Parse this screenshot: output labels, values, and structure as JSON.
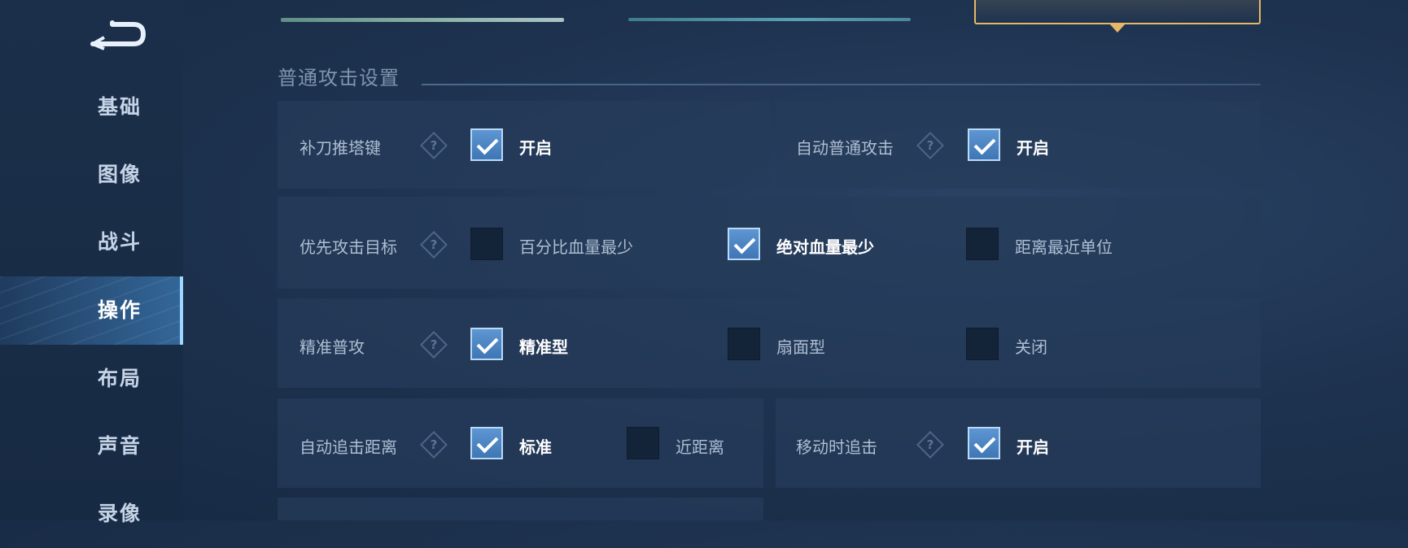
{
  "sidebar": {
    "items": [
      {
        "label": "基础"
      },
      {
        "label": "图像"
      },
      {
        "label": "战斗"
      },
      {
        "label": "操作"
      },
      {
        "label": "布局"
      },
      {
        "label": "声音"
      },
      {
        "label": "录像"
      }
    ],
    "active_index": 3
  },
  "tabs": {
    "active_index": 2,
    "count": 3
  },
  "section": {
    "title": "普通攻击设置"
  },
  "settings": {
    "last_hit": {
      "label": "补刀推塔键",
      "option": "开启",
      "checked": true
    },
    "auto_attack": {
      "label": "自动普通攻击",
      "option": "开启",
      "checked": true
    },
    "priority_target": {
      "label": "优先攻击目标",
      "options": [
        {
          "label": "百分比血量最少",
          "checked": false
        },
        {
          "label": "绝对血量最少",
          "checked": true
        },
        {
          "label": "距离最近单位",
          "checked": false
        }
      ]
    },
    "precise_attack": {
      "label": "精准普攻",
      "options": [
        {
          "label": "精准型",
          "checked": true
        },
        {
          "label": "扇面型",
          "checked": false
        },
        {
          "label": "关闭",
          "checked": false
        }
      ]
    },
    "chase_distance": {
      "label": "自动追击距离",
      "options": [
        {
          "label": "标准",
          "checked": true
        },
        {
          "label": "近距离",
          "checked": false
        }
      ]
    },
    "chase_while_moving": {
      "label": "移动时追击",
      "option": "开启",
      "checked": true
    }
  },
  "colors": {
    "accent_gold": "#e6b765",
    "check_blue": "#4f87c6",
    "panel": "#263c5a"
  },
  "icons": [
    "back-arrow-icon",
    "help-icon",
    "checkmark-icon"
  ]
}
